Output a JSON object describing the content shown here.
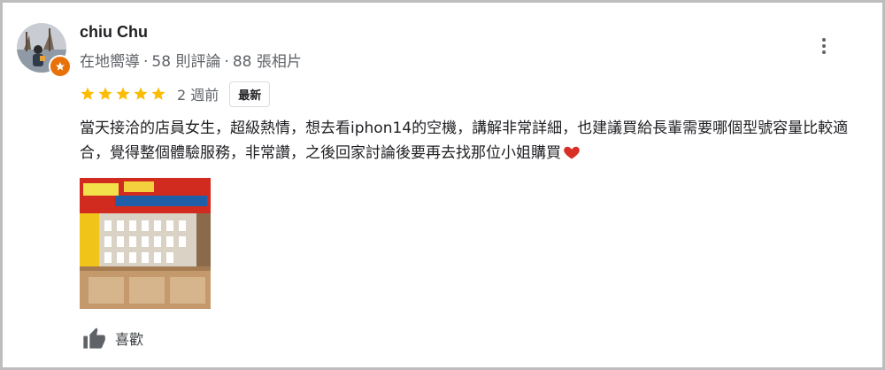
{
  "reviewer": {
    "name": "chiu Chu",
    "level": "在地嚮導",
    "reviews": "58 則評論",
    "photos": "88 張相片",
    "separator": "·"
  },
  "rating": {
    "stars": 5,
    "max_stars": 5,
    "star_color": "#fbbc04",
    "time_ago": "2 週前",
    "badge": "最新"
  },
  "review_text": "當天接洽的店員女生，超級熱情，想去看iphon14的空機，講解非常詳細，也建議買給長輩需要哪個型號容量比較適合，覺得整個體驗服務，非常讚，之後回家討論後要再去找那位小姐購買",
  "actions": {
    "like_label": "喜歡",
    "more_icon": "more-vert-icon"
  },
  "colors": {
    "accent_badge": "#e8710a",
    "heart": "#d93025",
    "border": "#bdbdbd"
  }
}
